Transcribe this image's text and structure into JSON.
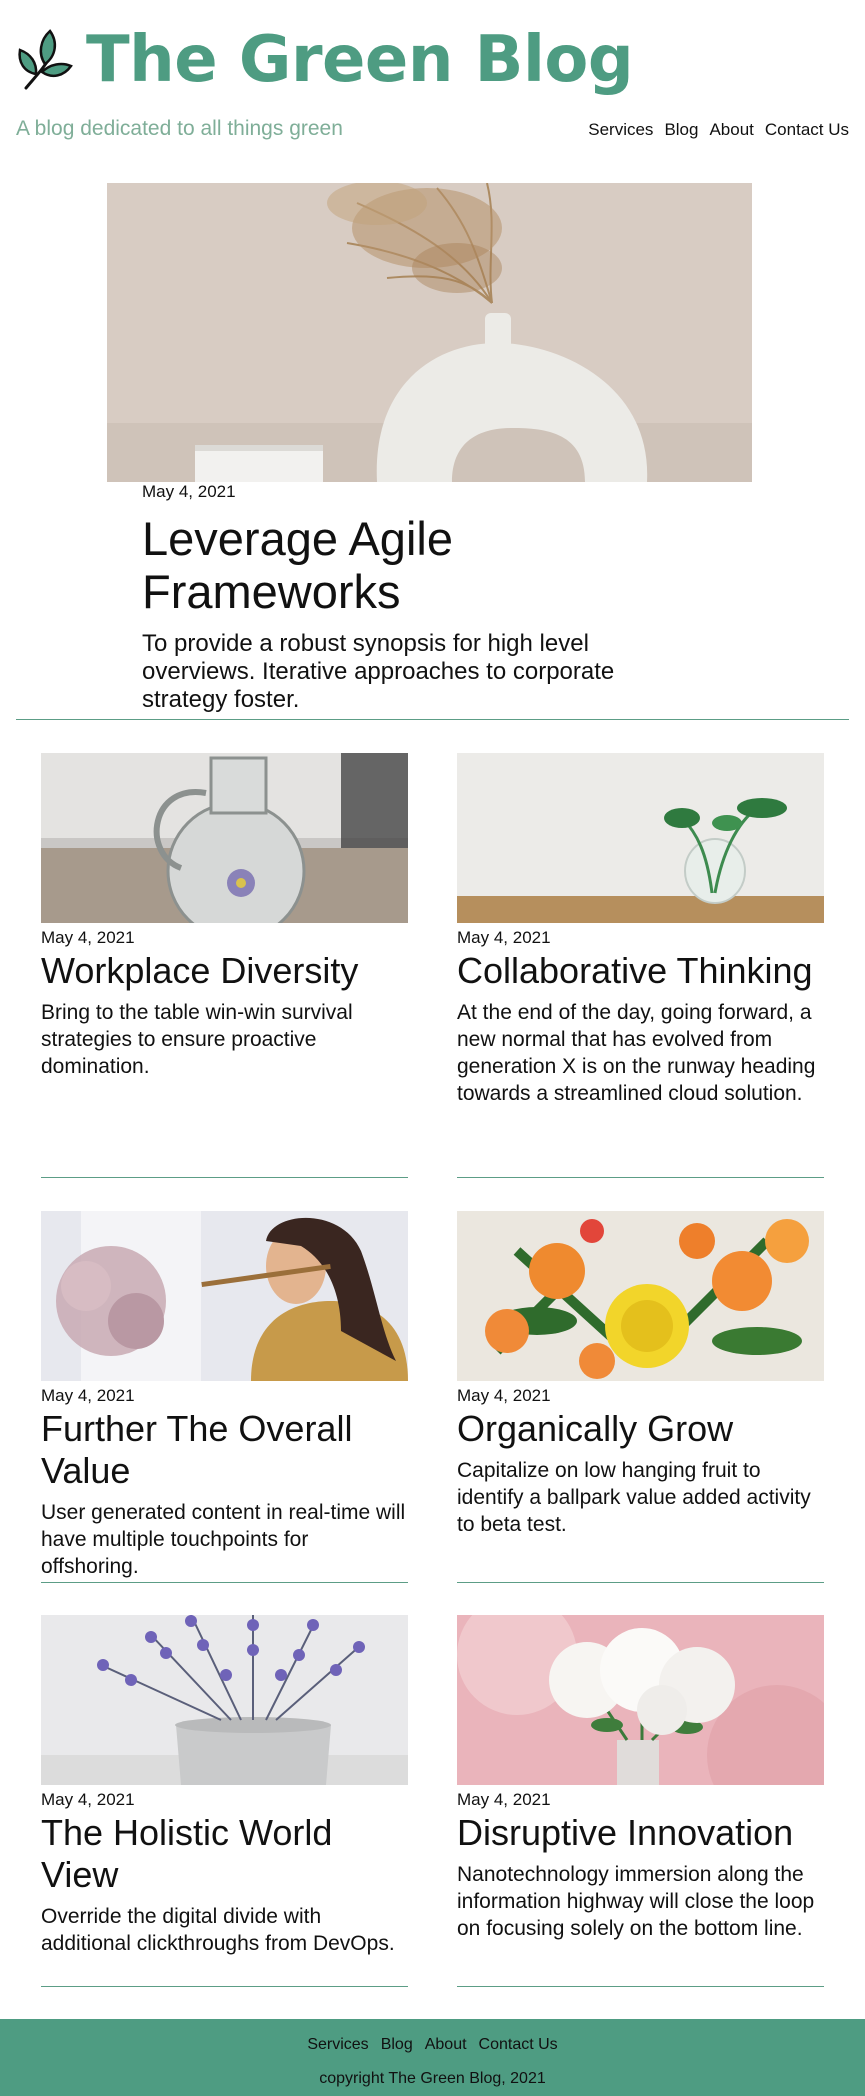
{
  "header": {
    "title": "The Green Blog",
    "tagline": "A blog dedicated to all things green",
    "logo_icon": "leaf-branch-icon",
    "nav": [
      "Services",
      "Blog",
      "About",
      "Contact Us"
    ]
  },
  "hero": {
    "image": "white-vase-with-dried-grass",
    "date": "May 4, 2021",
    "title": "Leverage Agile Frameworks",
    "excerpt": "To provide a robust synopsis for high level overviews. Iterative approaches to corporate strategy foster."
  },
  "posts": [
    {
      "image": "glass-jug-with-flower",
      "date": "May 4, 2021",
      "title": "Workplace Diversity",
      "excerpt": "Bring to the table win-win survival strategies to ensure proactive domination."
    },
    {
      "image": "plant-in-glass-vase",
      "date": "May 4, 2021",
      "title": "Collaborative Thinking",
      "excerpt": "At the end of the day, going forward, a new normal that has evolved from generation X is on the runway heading towards a streamlined cloud solution."
    },
    {
      "image": "woman-playing-flute",
      "date": "May 4, 2021",
      "title": "Further The Overall Value",
      "excerpt": "User generated content in real-time will have multiple touchpoints for offshoring."
    },
    {
      "image": "yellow-orange-bouquet",
      "date": "May 4, 2021",
      "title": "Organically Grow",
      "excerpt": "Capitalize on low hanging fruit to identify a ballpark value added activity to beta test."
    },
    {
      "image": "lavender-in-pot",
      "date": "May 4, 2021",
      "title": "The Holistic World View",
      "excerpt": "Override the digital divide with additional clickthroughs from DevOps."
    },
    {
      "image": "white-peonies",
      "date": "May 4, 2021",
      "title": "Disruptive Innovation",
      "excerpt": "Nanotechnology immersion along the information highway will close the loop on focusing solely on the bottom line."
    }
  ],
  "footer": {
    "nav": [
      "Services",
      "Blog",
      "About",
      "Contact Us"
    ],
    "copyright": "copyright The Green Blog, 2021"
  },
  "colors": {
    "brand": "#4e9c82",
    "tagline": "#7fae98",
    "rule": "#5c9d86"
  }
}
